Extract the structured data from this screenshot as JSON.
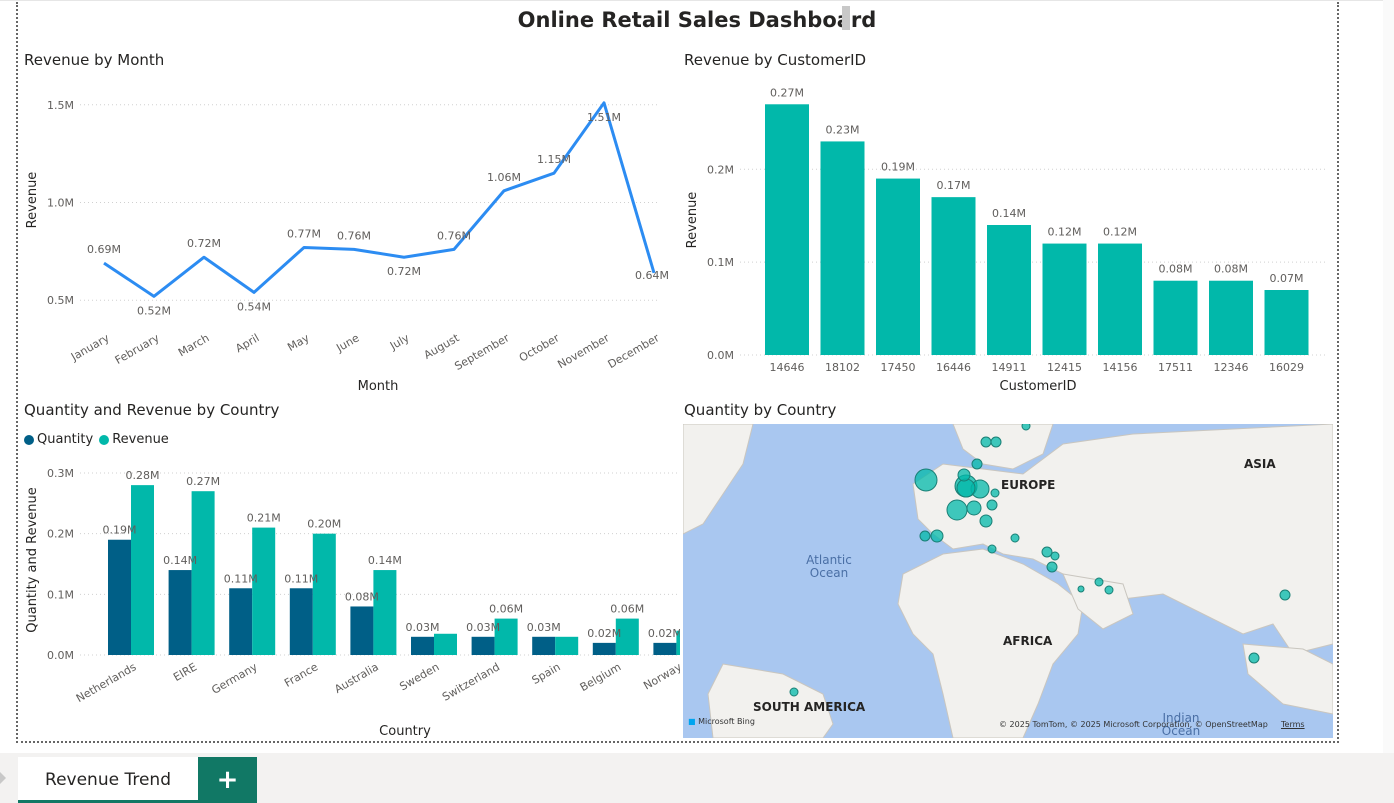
{
  "dashboard": {
    "title": "Online Retail Sales Dashboard",
    "tabs": [
      {
        "label": "Revenue Trend"
      }
    ],
    "add_tab_label": "+"
  },
  "colors": {
    "line": "#2C8CF2",
    "teal": "#01B8AA",
    "navy": "#005F87",
    "accent_dark": "#117865"
  },
  "chart_data": [
    {
      "type": "line",
      "title": "Revenue by Month",
      "xlabel": "Month",
      "ylabel": "Revenue",
      "categories": [
        "January",
        "February",
        "March",
        "April",
        "May",
        "June",
        "July",
        "August",
        "September",
        "October",
        "November",
        "December"
      ],
      "series": [
        {
          "name": "Revenue",
          "values": [
            0.69,
            0.52,
            0.72,
            0.54,
            0.77,
            0.76,
            0.72,
            0.76,
            1.06,
            1.15,
            1.51,
            0.64
          ]
        }
      ],
      "data_labels": [
        "0.69M",
        "0.52M",
        "0.72M",
        "0.54M",
        "0.77M",
        "0.76M",
        "0.72M",
        "0.76M",
        "1.06M",
        "1.15M",
        "1.51M",
        "0.64M"
      ],
      "yticks": [
        "0.5M",
        "1.0M",
        "1.5M"
      ],
      "ytick_values": [
        0.5,
        1.0,
        1.5
      ],
      "ylim": [
        0.45,
        1.55
      ],
      "unit": "M",
      "grid": true
    },
    {
      "type": "bar",
      "title": "Revenue by CustomerID",
      "xlabel": "CustomerID",
      "ylabel": "Revenue",
      "categories": [
        "14646",
        "18102",
        "17450",
        "16446",
        "14911",
        "12415",
        "14156",
        "17511",
        "12346",
        "16029"
      ],
      "values": [
        0.27,
        0.23,
        0.19,
        0.17,
        0.14,
        0.12,
        0.12,
        0.08,
        0.08,
        0.07
      ],
      "data_labels": [
        "0.27M",
        "0.23M",
        "0.19M",
        "0.17M",
        "0.14M",
        "0.12M",
        "0.12M",
        "0.08M",
        "0.08M",
        "0.07M"
      ],
      "yticks": [
        "0.0M",
        "0.1M",
        "0.2M"
      ],
      "ytick_values": [
        0,
        0.1,
        0.2
      ],
      "ylim": [
        0,
        0.28
      ],
      "unit": "M",
      "grid": true
    },
    {
      "type": "bar",
      "title": "Quantity and Revenue by Country",
      "xlabel": "Country",
      "ylabel": "Quantity and Revenue",
      "legend": [
        "Quantity",
        "Revenue"
      ],
      "legend_position": "top-left",
      "categories": [
        "Netherlands",
        "EIRE",
        "Germany",
        "France",
        "Australia",
        "Sweden",
        "Switzerland",
        "Spain",
        "Belgium",
        "Norway"
      ],
      "series": [
        {
          "name": "Quantity",
          "values": [
            0.19,
            0.14,
            0.11,
            0.11,
            0.08,
            0.03,
            0.03,
            0.03,
            0.02,
            0.02
          ],
          "labels": [
            "0.19M",
            "0.14M",
            "0.11M",
            "0.11M",
            "0.08M",
            "0.03M",
            "0.03M",
            "0.03M",
            "0.02M",
            "0.02M"
          ]
        },
        {
          "name": "Revenue",
          "values": [
            0.28,
            0.27,
            0.21,
            0.2,
            0.14,
            0.035,
            0.06,
            0.03,
            0.06,
            0.04
          ],
          "labels": [
            "0.28M",
            "0.27M",
            "0.21M",
            "0.20M",
            "0.14M",
            "",
            "0.06M",
            "",
            "0.06M",
            ""
          ]
        }
      ],
      "yticks": [
        "0.0M",
        "0.1M",
        "0.2M",
        "0.3M"
      ],
      "ytick_values": [
        0,
        0.1,
        0.2,
        0.3
      ],
      "ylim": [
        0,
        0.3
      ],
      "unit": "M",
      "grid": true
    },
    {
      "type": "map",
      "title": "Quantity by Country",
      "region_labels": [
        "EUROPE",
        "ASIA",
        "AFRICA",
        "SOUTH AMERICA"
      ],
      "ocean_labels": [
        "Atlantic Ocean",
        "Indian Ocean"
      ],
      "credits": {
        "bing": "Microsoft Bing",
        "copyright": "© 2025 TomTom, © 2025 Microsoft Corporation, © OpenStreetMap",
        "terms": "Terms"
      }
    }
  ]
}
